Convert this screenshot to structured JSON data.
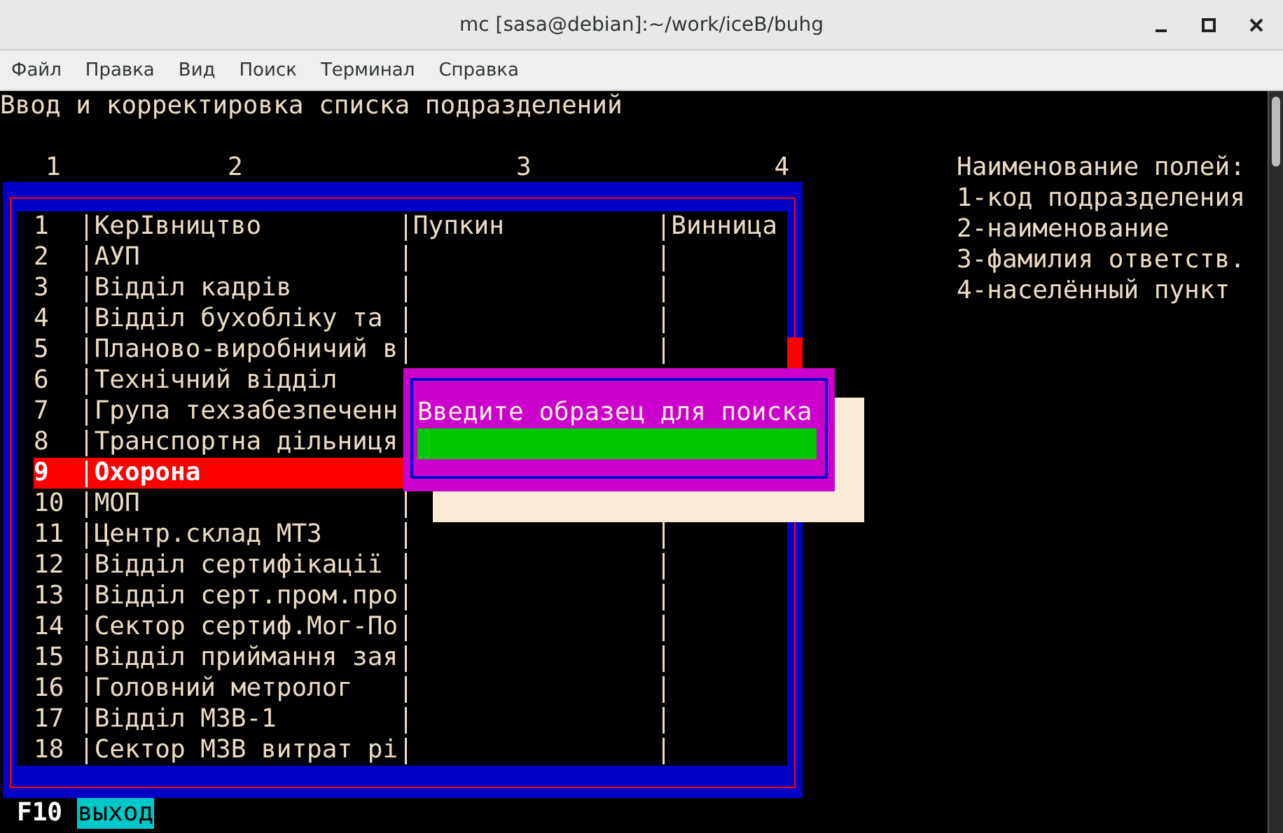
{
  "window": {
    "title": "mc [sasa@debian]:~/work/iceB/buhg"
  },
  "menu": [
    "Файл",
    "Правка",
    "Вид",
    "Поиск",
    "Терминал",
    "Справка"
  ],
  "screen": {
    "heading": "Ввод и корректировка списка подразделений",
    "column_numbers": [
      "1",
      "2",
      "3",
      "4"
    ],
    "legend": [
      "Наименование полей:",
      "1-код подразделения",
      "2-наименование",
      "3-фамилия ответств.",
      "4-населённый пункт"
    ],
    "rows": [
      {
        "code": "1",
        "name": "КерIвництво",
        "responsible": "Пупкин",
        "locality": "Винница",
        "selected": false
      },
      {
        "code": "2",
        "name": "АУП",
        "selected": false
      },
      {
        "code": "3",
        "name": "Відділ кадрів",
        "selected": false
      },
      {
        "code": "4",
        "name": "Відділ бухобліку та",
        "selected": false
      },
      {
        "code": "5",
        "name": "Планово-виробничий в",
        "selected": false
      },
      {
        "code": "6",
        "name": "Технічний відділ",
        "selected": false
      },
      {
        "code": "7",
        "name": "Група техзабезпеченн",
        "selected": false
      },
      {
        "code": "8",
        "name": "Транспортна дільниця",
        "selected": false
      },
      {
        "code": "9",
        "name": "Охорона",
        "selected": true
      },
      {
        "code": "10",
        "name": "МОП",
        "selected": false
      },
      {
        "code": "11",
        "name": "Центр.склад МТЗ",
        "selected": false
      },
      {
        "code": "12",
        "name": "Відділ сертифікації",
        "selected": false
      },
      {
        "code": "13",
        "name": "Відділ серт.пром.про",
        "selected": false
      },
      {
        "code": "14",
        "name": "Сектор сертиф.Мог-По",
        "selected": false
      },
      {
        "code": "15",
        "name": "Відділ приймання зая",
        "selected": false
      },
      {
        "code": "16",
        "name": "Головний метролог",
        "selected": false
      },
      {
        "code": "17",
        "name": "Відділ МЗВ-1",
        "selected": false
      },
      {
        "code": "18",
        "name": "Сектор МЗВ витрат рі",
        "selected": false
      }
    ],
    "search_dialog": {
      "prompt": "Введите образец для поиска"
    },
    "footer": {
      "key": "F10",
      "label": "выход"
    }
  }
}
